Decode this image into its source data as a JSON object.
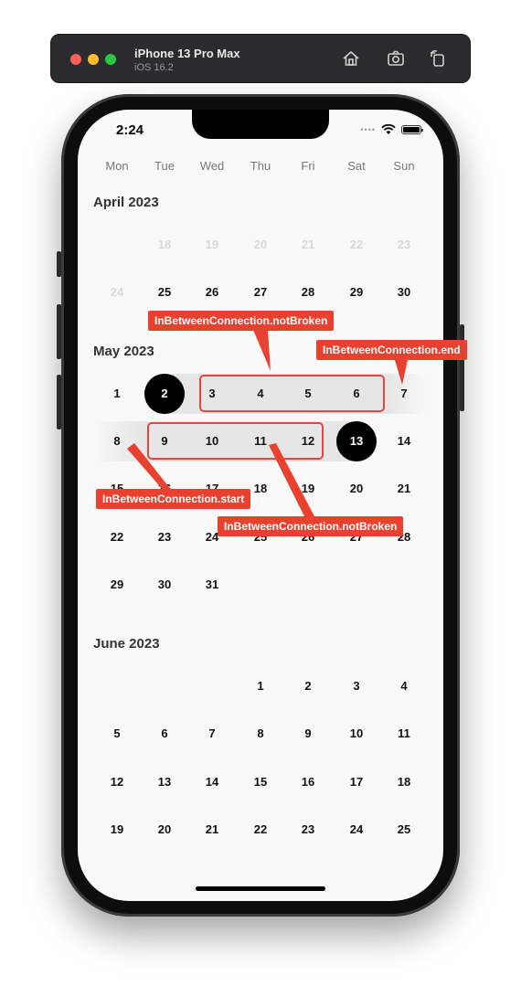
{
  "simulator": {
    "device_name": "iPhone 13 Pro Max",
    "os_version": "iOS 16.2",
    "icons": [
      "home-icon",
      "screenshot-icon",
      "rotate-icon"
    ]
  },
  "status_bar": {
    "time": "2:24",
    "signal": "••••"
  },
  "weekdays": [
    "Mon",
    "Tue",
    "Wed",
    "Thu",
    "Fri",
    "Sat",
    "Sun"
  ],
  "months": [
    {
      "title": "April 2023",
      "rows": [
        [
          "",
          "18",
          "19",
          "20",
          "21",
          "22",
          "23"
        ],
        [
          "24",
          "25",
          "26",
          "27",
          "28",
          "29",
          "30"
        ]
      ]
    },
    {
      "title": "May 2023",
      "rows": [
        [
          "1",
          "2",
          "3",
          "4",
          "5",
          "6",
          "7"
        ],
        [
          "8",
          "9",
          "10",
          "11",
          "12",
          "13",
          "14"
        ],
        [
          "15",
          "16",
          "17",
          "18",
          "19",
          "20",
          "21"
        ],
        [
          "22",
          "23",
          "24",
          "25",
          "26",
          "27",
          "28"
        ],
        [
          "29",
          "30",
          "31",
          "",
          "",
          "",
          ""
        ]
      ]
    },
    {
      "title": "June 2023",
      "rows": [
        [
          "",
          "",
          "",
          "1",
          "2",
          "3",
          "4"
        ],
        [
          "5",
          "6",
          "7",
          "8",
          "9",
          "10",
          "11"
        ],
        [
          "12",
          "13",
          "14",
          "15",
          "16",
          "17",
          "18"
        ],
        [
          "19",
          "20",
          "21",
          "22",
          "23",
          "24",
          "25"
        ]
      ]
    }
  ],
  "selection": {
    "start": "2",
    "end": "13"
  },
  "annotations": {
    "notbroken_top": "InBetweenConnection.notBroken",
    "end": "InBetweenConnection.end",
    "start": "InBetweenConnection.start",
    "notbroken_bottom": "InBetweenConnection.notBroken"
  },
  "colors": {
    "annotation": "#e8412f",
    "selected": "#000000",
    "band": "#e6e6e6"
  }
}
